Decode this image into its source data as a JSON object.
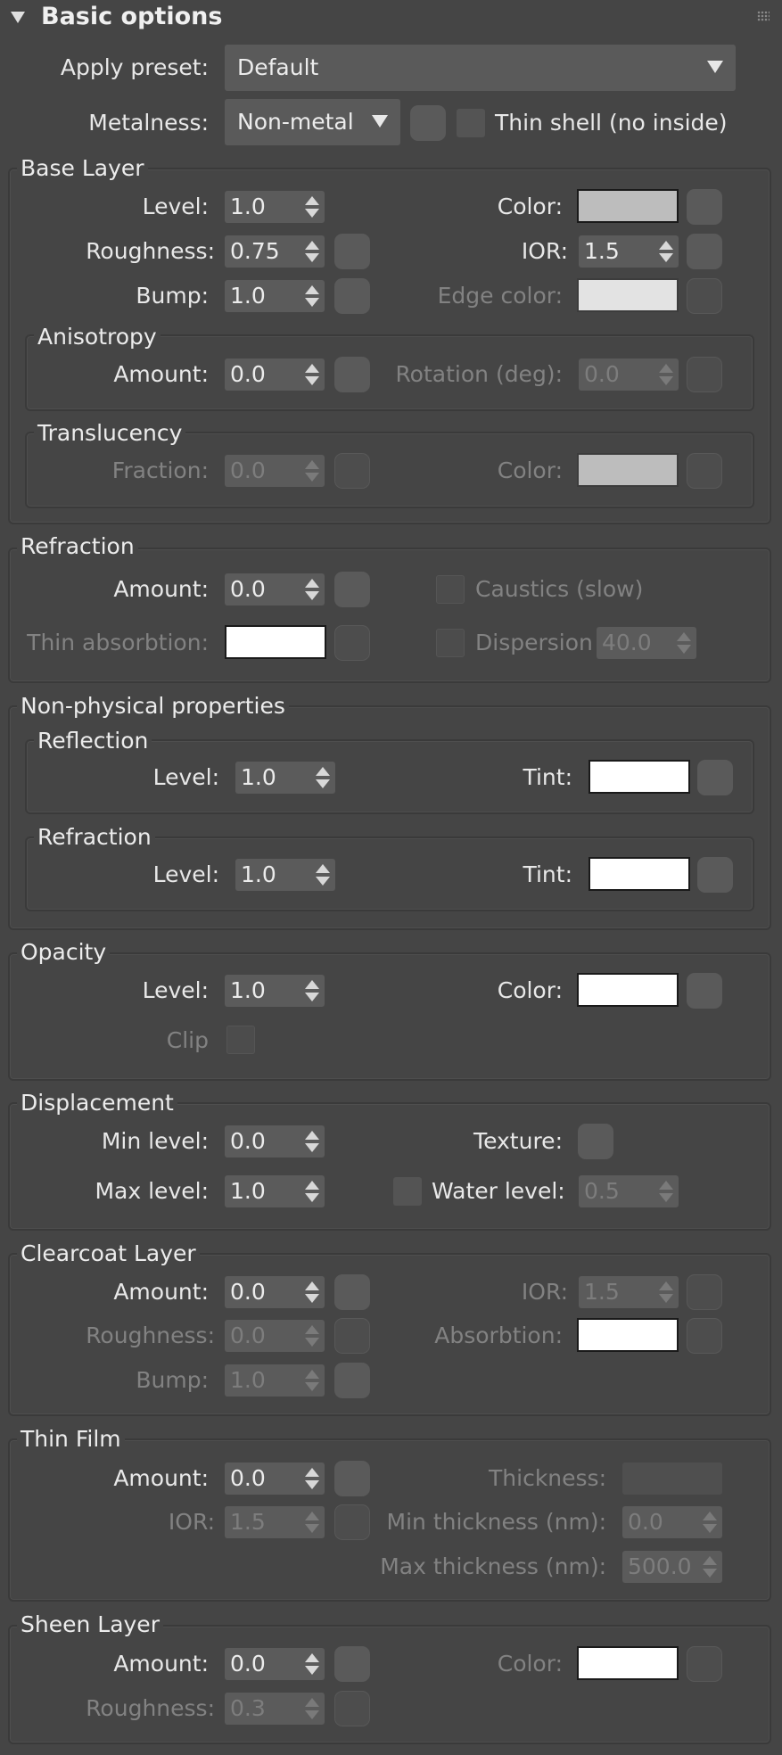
{
  "panel": {
    "title": "Basic options"
  },
  "top": {
    "apply_preset_label": "Apply preset:",
    "apply_preset_value": "Default",
    "metalness_label": "Metalness:",
    "metalness_value": "Non-metal",
    "thin_shell_label": "Thin shell (no inside)"
  },
  "base_layer": {
    "title": "Base Layer",
    "level_label": "Level:",
    "level_value": "1.0",
    "roughness_label": "Roughness:",
    "roughness_value": "0.75",
    "bump_label": "Bump:",
    "bump_value": "1.0",
    "color_label": "Color:",
    "color_swatch": "#bdbdbd",
    "ior_label": "IOR:",
    "ior_value": "1.5",
    "edge_color_label": "Edge color:",
    "edge_color_swatch": "#e3e3e3",
    "anisotropy": {
      "title": "Anisotropy",
      "amount_label": "Amount:",
      "amount_value": "0.0",
      "rotation_label": "Rotation (deg):",
      "rotation_value": "0.0"
    },
    "translucency": {
      "title": "Translucency",
      "fraction_label": "Fraction:",
      "fraction_value": "0.0",
      "color_label": "Color:",
      "color_swatch": "#bdbdbd"
    }
  },
  "refraction": {
    "title": "Refraction",
    "amount_label": "Amount:",
    "amount_value": "0.0",
    "thin_absorption_label": "Thin absorbtion:",
    "thin_absorption_swatch": "#ffffff",
    "caustics_label": "Caustics (slow)",
    "dispersion_label": "Dispersion",
    "dispersion_value": "40.0"
  },
  "non_physical": {
    "title": "Non-physical properties",
    "reflection": {
      "title": "Reflection",
      "level_label": "Level:",
      "level_value": "1.0",
      "tint_label": "Tint:",
      "tint_swatch": "#ffffff"
    },
    "refraction": {
      "title": "Refraction",
      "level_label": "Level:",
      "level_value": "1.0",
      "tint_label": "Tint:",
      "tint_swatch": "#ffffff"
    }
  },
  "opacity": {
    "title": "Opacity",
    "level_label": "Level:",
    "level_value": "1.0",
    "color_label": "Color:",
    "color_swatch": "#ffffff",
    "clip_label": "Clip"
  },
  "displacement": {
    "title": "Displacement",
    "min_level_label": "Min level:",
    "min_level_value": "0.0",
    "max_level_label": "Max level:",
    "max_level_value": "1.0",
    "texture_label": "Texture:",
    "water_level_label": "Water level:",
    "water_level_value": "0.5"
  },
  "clearcoat": {
    "title": "Clearcoat Layer",
    "amount_label": "Amount:",
    "amount_value": "0.0",
    "roughness_label": "Roughness:",
    "roughness_value": "0.0",
    "bump_label": "Bump:",
    "bump_value": "1.0",
    "ior_label": "IOR:",
    "ior_value": "1.5",
    "absorption_label": "Absorbtion:",
    "absorption_swatch": "#ffffff"
  },
  "thin_film": {
    "title": "Thin Film",
    "amount_label": "Amount:",
    "amount_value": "0.0",
    "ior_label": "IOR:",
    "ior_value": "1.5",
    "thickness_label": "Thickness:",
    "min_thickness_label": "Min thickness (nm):",
    "min_thickness_value": "0.0",
    "max_thickness_label": "Max thickness (nm):",
    "max_thickness_value": "500.0"
  },
  "sheen": {
    "title": "Sheen Layer",
    "amount_label": "Amount:",
    "amount_value": "0.0",
    "roughness_label": "Roughness:",
    "roughness_value": "0.3",
    "color_label": "Color:",
    "color_swatch": "#ffffff"
  }
}
